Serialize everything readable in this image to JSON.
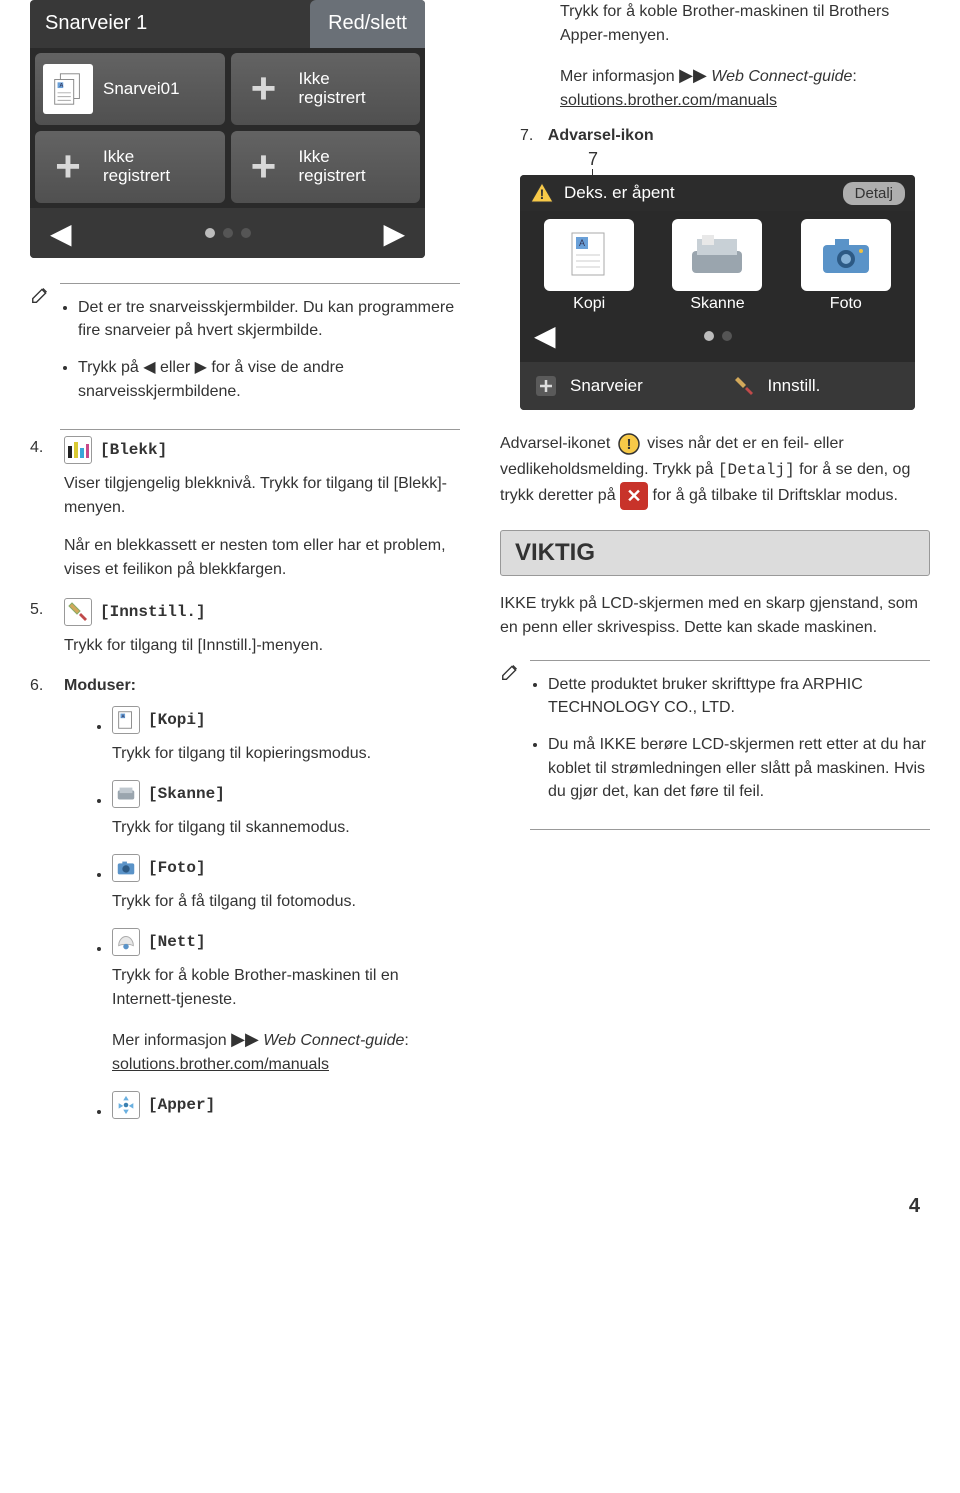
{
  "shortcut_screen": {
    "title": "Snarveier 1",
    "edit_btn": "Red/slett",
    "tiles": [
      {
        "label": "Snarvei01",
        "kind": "doc"
      },
      {
        "label": "Ikke\nregistrert",
        "kind": "plus"
      },
      {
        "label": "Ikke\nregistrert",
        "kind": "plus"
      },
      {
        "label": "Ikke\nregistrert",
        "kind": "plus"
      }
    ]
  },
  "left_notes": [
    "Det er tre snarveisskjermbilder. Du kan programmere fire snarveier på hvert skjermbilde.",
    "Trykk på ◀ eller ▶ for å vise de andre snarveisskjermbildene."
  ],
  "items": {
    "blekk": {
      "name": "[Blekk]",
      "p1": "Viser tilgjengelig blekknivå. Trykk for tilgang til [Blekk]-menyen.",
      "p2": "Når en blekkassett er nesten tom eller har et problem, vises et feilikon på blekkfargen."
    },
    "innstill": {
      "name": "[Innstill.]",
      "p1": "Trykk for tilgang til [Innstill.]-menyen."
    },
    "moduser": {
      "name": "Moduser:",
      "kopi": {
        "name": "[Kopi]",
        "text": "Trykk for tilgang til kopieringsmodus."
      },
      "skanne": {
        "name": "[Skanne]",
        "text": "Trykk for tilgang til skannemodus."
      },
      "foto": {
        "name": "[Foto]",
        "text": "Trykk for å få tilgang til fotomodus."
      },
      "nett": {
        "name": "[Nett]",
        "text": "Trykk for å koble Brother-maskinen til en Internett-tjeneste.",
        "more_prefix": "Mer informasjon ",
        "more_mid": " Web Connect-guide",
        "more_link": "solutions.brother.com/manuals"
      },
      "apper": {
        "name": "[Apper]"
      }
    }
  },
  "right_intro": {
    "p1": "Trykk for å koble Brother-maskinen til Brothers Apper-menyen.",
    "more_prefix": "Mer informasjon ",
    "more_mid": " Web Connect-guide",
    "more_link": "solutions.brother.com/manuals",
    "advarsel_num": "7.",
    "advarsel_title": "Advarsel-ikon"
  },
  "home_screen": {
    "callout": "7",
    "status_text": "Deks. er åpent",
    "detalj": "Detalj",
    "modes": [
      "Kopi",
      "Skanne",
      "Foto"
    ],
    "bottom": {
      "snarveier": "Snarveier",
      "innstill": "Innstill."
    }
  },
  "advarsel_para": {
    "t1": "Advarsel-ikonet ",
    "t2": " vises når det er en feil- eller vedlikeholdsmelding. Trykk på ",
    "t3": " for å se den, og trykk deretter på ",
    "t4": " for å gå tilbake til Driftsklar modus.",
    "detalj_code": "[Detalj]"
  },
  "viktig": {
    "title": "VIKTIG",
    "text": "IKKE trykk på LCD-skjermen med en skarp gjenstand, som en penn eller skrivespiss. Dette kan skade maskinen."
  },
  "right_notes": [
    "Dette produktet bruker skrifttype fra ARPHIC TECHNOLOGY CO., LTD.",
    "Du må IKKE berøre LCD-skjermen rett etter at du har koblet til strømledningen eller slått på maskinen. Hvis du gjør det, kan det føre til feil."
  ],
  "page_number": "4"
}
